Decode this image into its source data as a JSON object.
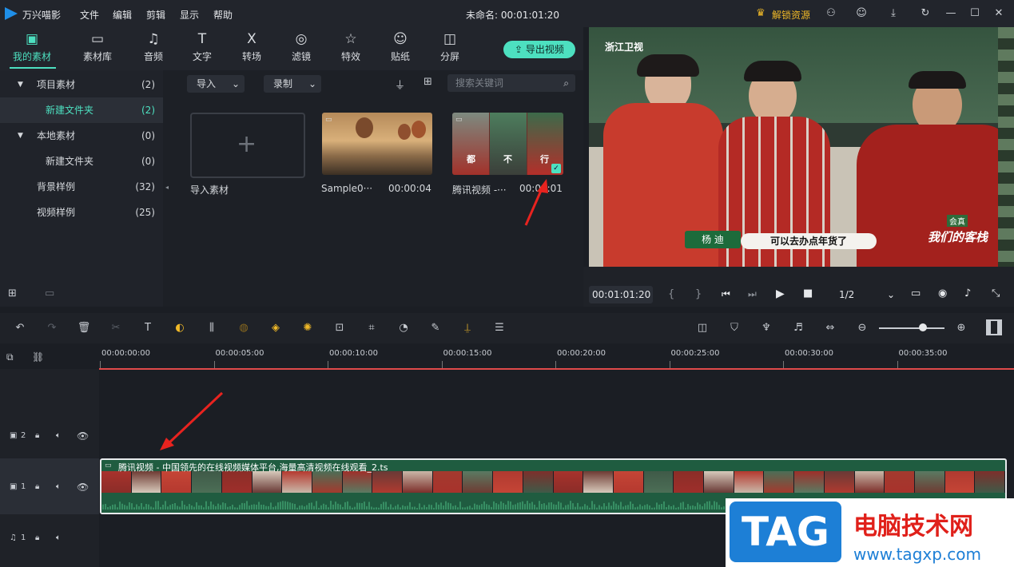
{
  "app": {
    "name": "万兴喵影",
    "title": "未命名: 00:01:01:20",
    "unlock": "解锁资源"
  },
  "menu": [
    "文件",
    "编辑",
    "剪辑",
    "显示",
    "帮助"
  ],
  "toolbar": {
    "tools": [
      {
        "label": "我的素材",
        "icon": "folder-stack-icon",
        "glyph": "▣",
        "active": true
      },
      {
        "label": "素材库",
        "icon": "folder-icon",
        "glyph": "▭",
        "active": false
      },
      {
        "label": "音频",
        "icon": "music-note-icon",
        "glyph": "♫",
        "active": false
      },
      {
        "label": "文字",
        "icon": "text-icon",
        "glyph": "T",
        "active": false
      },
      {
        "label": "转场",
        "icon": "transition-icon",
        "glyph": "Ⅹ",
        "active": false
      },
      {
        "label": "滤镜",
        "icon": "filter-icon",
        "glyph": "◎",
        "active": false
      },
      {
        "label": "特效",
        "icon": "effects-star-icon",
        "glyph": "☆",
        "active": false
      },
      {
        "label": "贴纸",
        "icon": "sticker-icon",
        "glyph": "☺",
        "active": false
      },
      {
        "label": "分屏",
        "icon": "split-screen-icon",
        "glyph": "◫",
        "active": false
      }
    ],
    "export_label": "导出视频"
  },
  "sidebar": {
    "items": [
      {
        "label": "项目素材",
        "count": "(2)",
        "expanded": true
      },
      {
        "label": "新建文件夹",
        "count": "(2)",
        "selected": true
      },
      {
        "label": "本地素材",
        "count": "(0)",
        "expanded": true
      },
      {
        "label": "新建文件夹",
        "count": "(0)"
      },
      {
        "label": "背景样例",
        "count": "(32)"
      },
      {
        "label": "视频样例",
        "count": "(25)"
      }
    ]
  },
  "media": {
    "import_label": "导入",
    "record_label": "录制",
    "search_placeholder": "搜索关键词",
    "tiles": [
      {
        "name": "导入素材",
        "duration": ""
      },
      {
        "name": "Sample0···",
        "duration": "00:00:04"
      },
      {
        "name": "腾讯视频 -···",
        "duration": "00:00:01"
      }
    ],
    "tile3_captions": [
      "都",
      "不",
      "行"
    ]
  },
  "preview": {
    "channel": "浙江卫视",
    "name_tag": "杨 迪",
    "subtitle": "可以去办点年货了",
    "show_logo": "我们的客栈",
    "show_logo_top": "会真",
    "timecode": "00:01:01:20",
    "zoom_ratio": "1/2",
    "progress": 0.97
  },
  "timeline": {
    "ruler_labels": [
      "00:00:00:00",
      "00:00:05:00",
      "00:00:10:00",
      "00:00:15:00",
      "00:00:20:00",
      "00:00:25:00",
      "00:00:30:00",
      "00:00:35:00"
    ],
    "tracks": [
      {
        "label": "2",
        "type": "video"
      },
      {
        "label": "1",
        "type": "video"
      },
      {
        "label": "1",
        "type": "audio"
      }
    ],
    "clip_title": "腾讯视频 - 中国领先的在线视频媒体平台,海量高清视频在线观看_2.ts"
  },
  "watermark": {
    "tag": "TAG",
    "site_cn": "电脑技术网",
    "url": "www.tagxp.com"
  },
  "colors": {
    "accent": "#4de0c0",
    "bg": "#1b1e24",
    "panel": "#22252c",
    "playhead": "#e04a4a",
    "clip": "#1f5c40",
    "arrow": "#e8231f"
  }
}
